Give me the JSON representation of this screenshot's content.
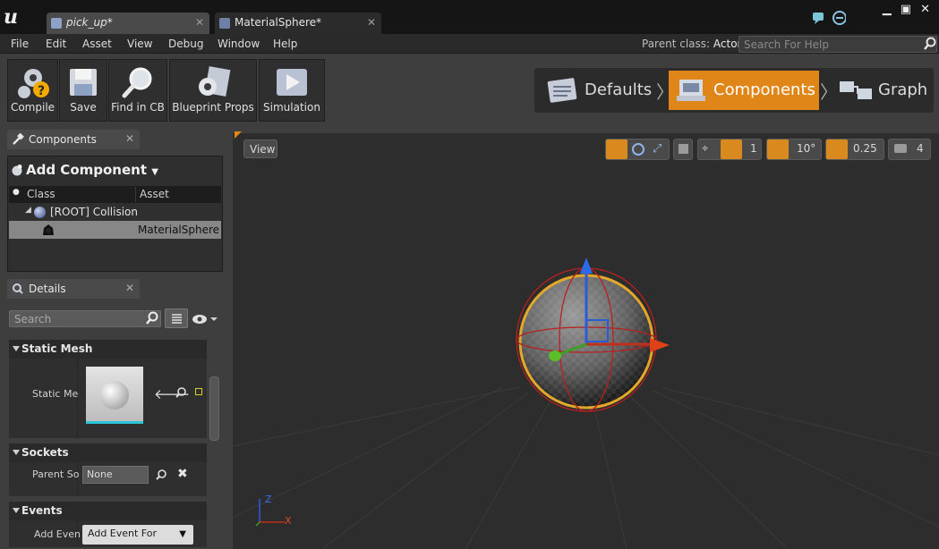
{
  "tabs": [
    {
      "label": "pick_up*",
      "icon": "blueprint-icon"
    },
    {
      "label": "MaterialSphere*",
      "icon": "material-icon"
    }
  ],
  "menu": [
    "File",
    "Edit",
    "Asset",
    "View",
    "Debug",
    "Window",
    "Help"
  ],
  "parent_class": {
    "label": "Parent class:",
    "value": "Actor"
  },
  "help_search": {
    "placeholder": "Search For Help"
  },
  "toolbar": {
    "compile": "Compile",
    "save": "Save",
    "find_in_cb": "Find in CB",
    "blueprint_props": "Blueprint Props",
    "simulation": "Simulation"
  },
  "modes": {
    "defaults": "Defaults",
    "components": "Components",
    "graph": "Graph",
    "active": "Components",
    "active_color": "#e08518"
  },
  "components_panel": {
    "tab": "Components",
    "add_component": "Add Component",
    "col_class": "Class",
    "col_asset": "Asset",
    "root_item": "[ROOT] Collision",
    "child_item": "MaterialSphere"
  },
  "details_panel": {
    "tab": "Details",
    "search_placeholder": "Search",
    "sections": {
      "static_mesh": "Static Mesh",
      "sockets": "Sockets",
      "events": "Events"
    },
    "static_mesh_label": "Static Me",
    "parent_socket_label": "Parent So",
    "parent_socket_value": "None",
    "add_event_label": "Add Even",
    "add_event_value": "Add Event For"
  },
  "viewport": {
    "view_button": "View",
    "grid_snap": "1",
    "rotation_snap": "10°",
    "scale_snap": "0.25",
    "camera_speed": "4",
    "axis_labels": {
      "x": "X",
      "z": "Z"
    }
  }
}
